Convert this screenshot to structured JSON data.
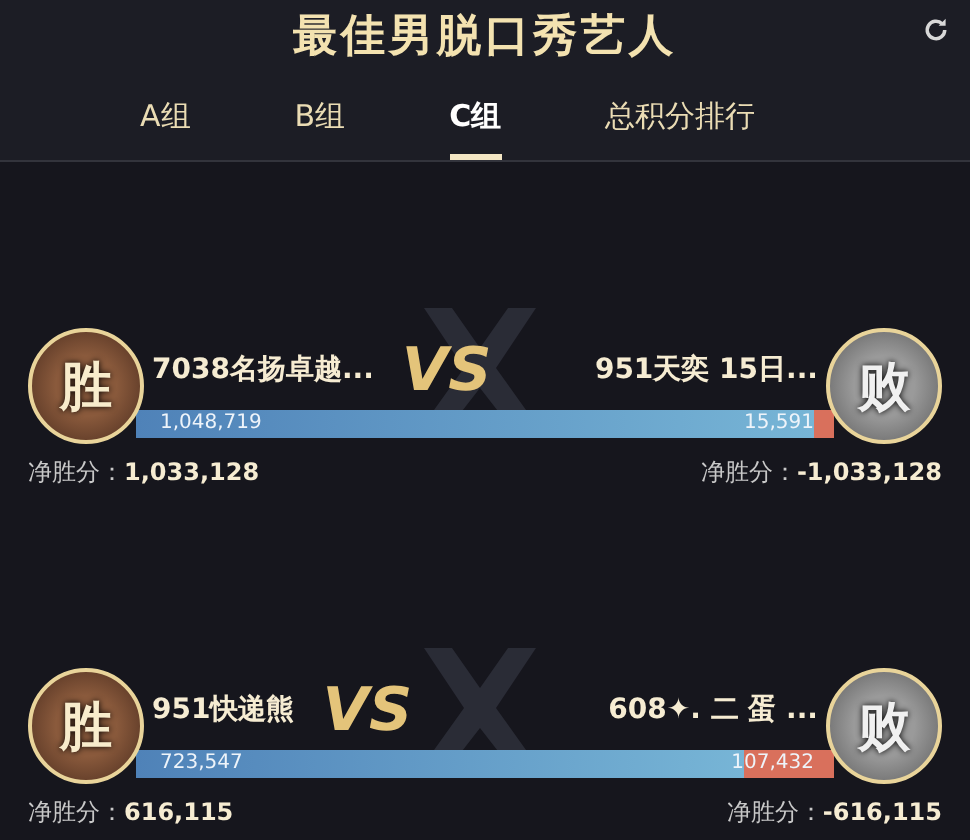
{
  "title": "最佳男脱口秀艺人",
  "tabs": [
    {
      "label": "A组",
      "selected": false
    },
    {
      "label": "B组",
      "selected": false
    },
    {
      "label": "C组",
      "selected": true
    },
    {
      "label": "总积分排行",
      "selected": false
    }
  ],
  "matches": [
    {
      "vs": "VS",
      "level": 0.97,
      "left": {
        "badge": "胜",
        "name": "7038名扬卓越...",
        "score": "1,048,719",
        "net_label": "净胜分：",
        "net": "1,033,128"
      },
      "right": {
        "badge": "败",
        "name": "951天奕 15日...",
        "score": "15,591",
        "net_label": "净胜分：",
        "net": "-1,033,128"
      }
    },
    {
      "vs": "VS",
      "level": 0.87,
      "left": {
        "badge": "胜",
        "name": "951快递熊",
        "score": "723,547",
        "net_label": "净胜分：",
        "net": "616,115"
      },
      "right": {
        "badge": "败",
        "name": "608✦. 二 蛋 ...",
        "score": "107,432",
        "net_label": "净胜分：",
        "net": "-616,115"
      }
    }
  ]
}
